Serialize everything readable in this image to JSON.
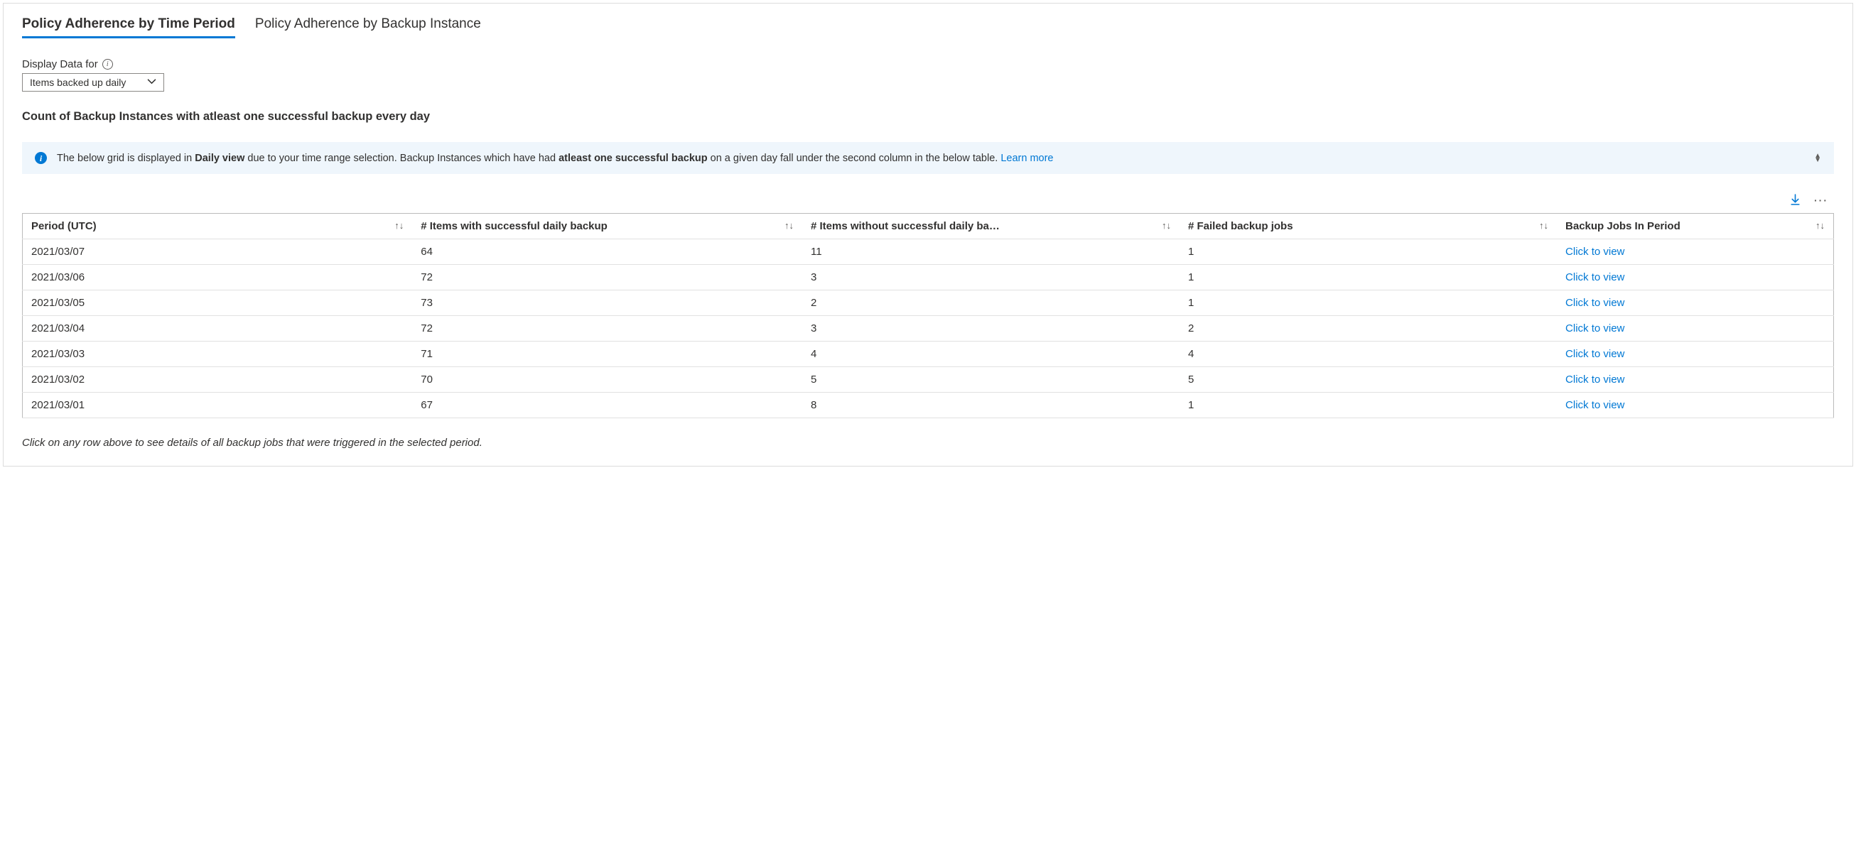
{
  "tabs": {
    "time_period": "Policy Adherence by Time Period",
    "backup_instance": "Policy Adherence by Backup Instance"
  },
  "filter": {
    "label": "Display Data for",
    "selected": "Items backed up daily"
  },
  "section_title": "Count of Backup Instances with atleast one successful backup every day",
  "banner": {
    "pre": "The below grid is displayed in ",
    "b1": "Daily view",
    "mid": " due to your time range selection. Backup Instances which have had ",
    "b2": "atleast one successful backup",
    "post": " on a given day fall under the second column in the below table. ",
    "learn_more": "Learn more"
  },
  "columns": {
    "period": "Period (UTC)",
    "with_success": "# Items with successful daily backup",
    "without_success": "# Items without successful daily ba…",
    "failed_jobs": "# Failed backup jobs",
    "jobs_in_period": "Backup Jobs In Period"
  },
  "link_label": "Click to view",
  "rows": [
    {
      "period": "2021/03/07",
      "with": "64",
      "without": "11",
      "failed": "1"
    },
    {
      "period": "2021/03/06",
      "with": "72",
      "without": "3",
      "failed": "1"
    },
    {
      "period": "2021/03/05",
      "with": "73",
      "without": "2",
      "failed": "1"
    },
    {
      "period": "2021/03/04",
      "with": "72",
      "without": "3",
      "failed": "2"
    },
    {
      "period": "2021/03/03",
      "with": "71",
      "without": "4",
      "failed": "4"
    },
    {
      "period": "2021/03/02",
      "with": "70",
      "without": "5",
      "failed": "5"
    },
    {
      "period": "2021/03/01",
      "with": "67",
      "without": "8",
      "failed": "1"
    }
  ],
  "footnote": "Click on any row above to see details of all backup jobs that were triggered in the selected period."
}
